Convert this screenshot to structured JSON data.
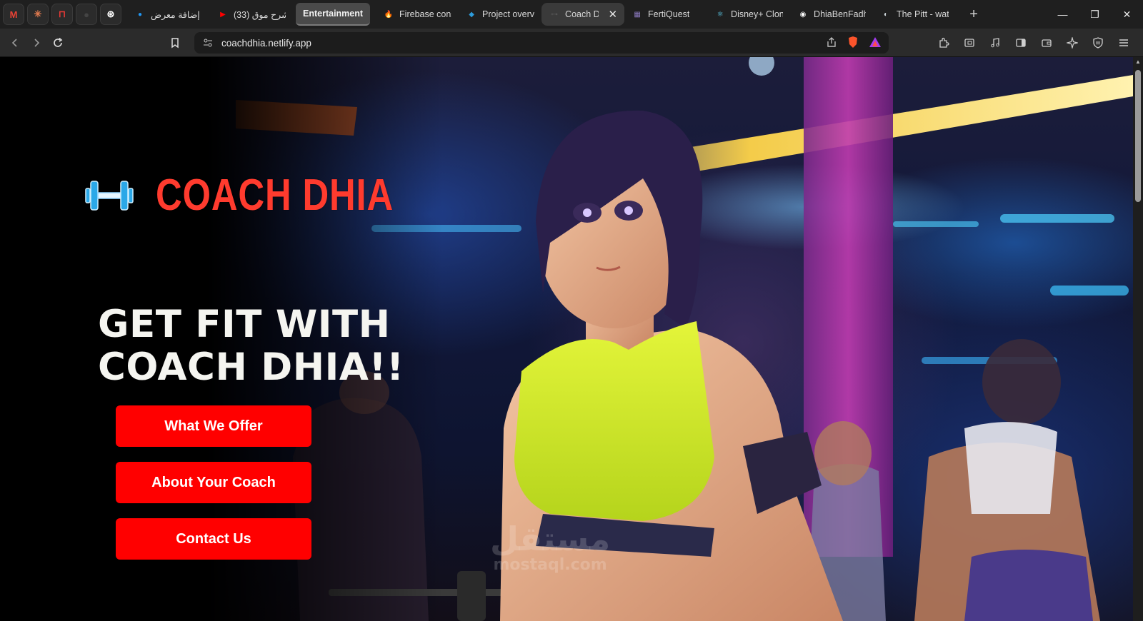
{
  "browser": {
    "pinned_tabs": [
      {
        "name": "gmail",
        "glyph": "M",
        "color": "#ea4335"
      },
      {
        "name": "claude",
        "glyph": "✳",
        "color": "#e07a4f"
      },
      {
        "name": "app",
        "glyph": "⊓",
        "color": "#e53935"
      },
      {
        "name": "blank",
        "glyph": "●",
        "color": "#444444"
      },
      {
        "name": "chatgpt",
        "glyph": "⊛",
        "color": "#ffffff"
      }
    ],
    "tabs": [
      {
        "title": "إضافة معرض",
        "fav": "●",
        "fav_color": "#2196f3"
      },
      {
        "title": "(33) شرح موق",
        "fav": "▶",
        "fav_color": "#ff0000"
      },
      {
        "title": "Entertainment",
        "group": true
      },
      {
        "title": "Firebase cons",
        "fav": "🔥",
        "fav_color": "#ffa000"
      },
      {
        "title": "Project overvi",
        "fav": "◆",
        "fav_color": "#2d9cdb"
      },
      {
        "title": "Coach Di",
        "fav": "⊶",
        "fav_color": "#555555",
        "active": true
      },
      {
        "title": "FertiQuest",
        "fav": "▦",
        "fav_color": "#8e7cc3"
      },
      {
        "title": "Disney+ Clon",
        "fav": "⚛",
        "fav_color": "#61dafb"
      },
      {
        "title": "DhiaBenFadh",
        "fav": "◉",
        "fav_color": "#ffffff"
      },
      {
        "title": "The Pitt - wat",
        "fav": "◐",
        "fav_color": "#cfd8dc"
      }
    ],
    "url": "coachdhia.netlify.app"
  },
  "page": {
    "brand": "COACH DHIA",
    "headline_line1": "GET FIT WITH",
    "headline_line2": "COACH DHIA!!",
    "buttons": {
      "offer": "What We Offer",
      "about": "About Your Coach",
      "contact": "Contact Us"
    },
    "watermark_line1": "مستقل",
    "watermark_line2": "mostaql.com",
    "colors": {
      "brand": "#ff3b2e",
      "button": "#ff0000",
      "headline": "#f5f5f0"
    }
  }
}
